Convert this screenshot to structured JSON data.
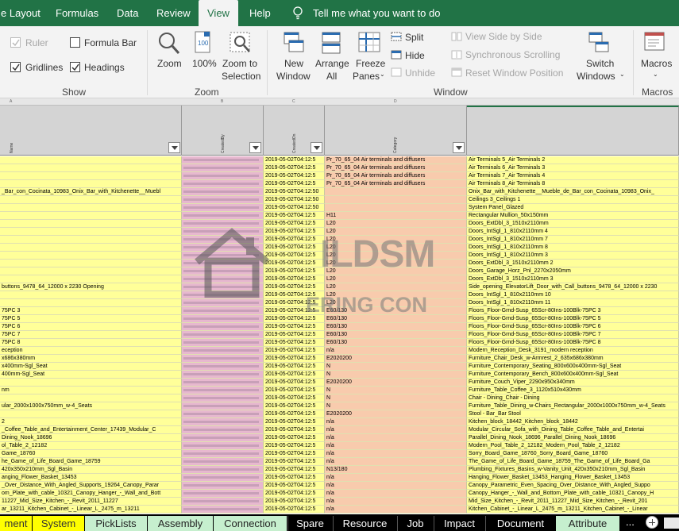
{
  "ribbon_tabs": [
    {
      "label": "e Layout"
    },
    {
      "label": "Formulas"
    },
    {
      "label": "Data"
    },
    {
      "label": "Review"
    },
    {
      "label": "View"
    },
    {
      "label": "Help"
    }
  ],
  "tell_me": "Tell me what you want to do",
  "show_group": {
    "label": "Show",
    "ruler": "Ruler",
    "formula_bar": "Formula Bar",
    "gridlines": "Gridlines",
    "headings": "Headings"
  },
  "zoom_group": {
    "label": "Zoom",
    "zoom": "Zoom",
    "hundred": "100%",
    "zoom_to_sel_1": "Zoom to",
    "zoom_to_sel_2": "Selection"
  },
  "window_group": {
    "label": "Window",
    "new_window_1": "New",
    "new_window_2": "Window",
    "arrange_1": "Arrange",
    "arrange_2": "All",
    "freeze_1": "Freeze",
    "freeze_2": "Panes",
    "split": "Split",
    "hide": "Hide",
    "unhide": "Unhide",
    "side_by_side": "View Side by Side",
    "sync_scroll": "Synchronous Scrolling",
    "reset_pos": "Reset Window Position",
    "switch_1": "Switch",
    "switch_2": "Windows"
  },
  "macros_group": {
    "label": "Macros",
    "macros": "Macros"
  },
  "column_letters": [
    "A",
    "B",
    "C",
    "D"
  ],
  "headers": {
    "name": "Name",
    "created_by": "CreatedBy",
    "created_on": "CreatedOn",
    "category": "Category"
  },
  "rows": [
    {
      "a": "",
      "c": "2019-05-02T04:12:5",
      "d": "Pr_70_65_04 Air terminals and diffusers",
      "e": "Air Terminals 5_Air Terminals 2"
    },
    {
      "a": "",
      "c": "2019-05-02T04:12:5",
      "d": "Pr_70_65_04 Air terminals and diffusers",
      "e": "Air Terminals 6_Air Terminals 3"
    },
    {
      "a": "",
      "c": "2019-05-02T04:12:5",
      "d": "Pr_70_65_04 Air terminals and diffusers",
      "e": "Air Terminals 7_Air Terminals 4"
    },
    {
      "a": "",
      "c": "2019-05-02T04:12:5",
      "d": "Pr_70_65_04 Air terminals and diffusers",
      "e": "Air Terminals 8_Air Terminals 8"
    },
    {
      "a": "_Bar_con_Cocinata_10983_Onix_Bar_with_Kitchenette__Muebl",
      "c": "2019-05-02T04:12:50",
      "d": "",
      "e": "Onix_Bar_with_Kitchenette__Mueble_de_Bar_con_Cocinata_10983_Onix_"
    },
    {
      "a": "",
      "c": "2019-05-02T04:12:50",
      "d": "",
      "e": "Ceilings 3_Ceilings 1"
    },
    {
      "a": "",
      "c": "2019-05-02T04:12:50",
      "d": "",
      "e": "System Panel_Glazed"
    },
    {
      "a": "",
      "c": "2019-05-02T04:12:5",
      "d": "H11",
      "e": "Rectangular Mullion_50x150mm"
    },
    {
      "a": "",
      "c": "2019-05-02T04:12:5",
      "d": "L20",
      "e": "Doors_ExtDbl_3_1510x2110mm"
    },
    {
      "a": "",
      "c": "2019-05-02T04:12:5",
      "d": "L20",
      "e": "Doors_IntSgl_1_810x2110mm 4"
    },
    {
      "a": "",
      "c": "2019-05-02T04:12:5",
      "d": "L20",
      "e": "Doors_IntSgl_1_810x2110mm 7"
    },
    {
      "a": "",
      "c": "2019-05-02T04:12:5",
      "d": "L20",
      "e": "Doors_IntSgl_1_810x2110mm 8"
    },
    {
      "a": "",
      "c": "2019-05-02T04:12:5",
      "d": "L20",
      "e": "Doors_IntSgl_1_810x2110mm 3"
    },
    {
      "a": "",
      "c": "2019-05-02T04:12:5",
      "d": "L20",
      "e": "Doors_ExtDbl_3_1510x2110mm 2"
    },
    {
      "a": "",
      "c": "2019-05-02T04:12:5",
      "d": "L20",
      "e": "Doors_Garage_Horz_Pnl_2270x2050mm"
    },
    {
      "a": "",
      "c": "2019-05-02T04:12:5",
      "d": "L20",
      "e": "Doors_ExtDbl_3_1510x2110mm 3"
    },
    {
      "a": "buttons_9478_64_12000 x 2230 Opening",
      "c": "2019-05-02T04:12:5",
      "d": "L20",
      "e": "Side_opening_ElevatorLift_Door_with_Call_buttons_9478_64_12000 x 2230"
    },
    {
      "a": "",
      "c": "2019-05-02T04:12:5",
      "d": "L20",
      "e": "Doors_IntSgl_1_810x2110mm 10"
    },
    {
      "a": "",
      "c": "2019-05-02T04:12:5",
      "d": "L20",
      "e": "Doors_IntSgl_1_810x2110mm 11"
    },
    {
      "a": "75PC 3",
      "c": "2019-05-02T04:12:5",
      "d": "E60/130",
      "e": "Floors_Floor-Grnd-Susp_65Scr-80Ins-100Blk-75PC 3"
    },
    {
      "a": "75PC 5",
      "c": "2019-05-02T04:12:5",
      "d": "E60/130",
      "e": "Floors_Floor-Grnd-Susp_65Scr-80Ins-100Blk-75PC 5"
    },
    {
      "a": "75PC 6",
      "c": "2019-05-02T04:12:5",
      "d": "E60/130",
      "e": "Floors_Floor-Grnd-Susp_65Scr-80Ins-100Blk-75PC 6"
    },
    {
      "a": "75PC 7",
      "c": "2019-05-02T04:12:5",
      "d": "E60/130",
      "e": "Floors_Floor-Grnd-Susp_65Scr-80Ins-100Blk-75PC 7"
    },
    {
      "a": "75PC 8",
      "c": "2019-05-02T04:12:5",
      "d": "E60/130",
      "e": "Floors_Floor-Grnd-Susp_65Scr-80Ins-100Blk-75PC 8"
    },
    {
      "a": "eception",
      "c": "2019-05-02T04:12:5",
      "d": "n/a",
      "e": "Modern_Reception_Desk_3191_modern reception"
    },
    {
      "a": "x686x380mm",
      "c": "2019-05-02T04:12:5",
      "d": "E2020200",
      "e": "Furniture_Chair_Desk_w-Armrest_2_635x686x380mm"
    },
    {
      "a": "x400mm-Sgl_Seat",
      "c": "2019-05-02T04:12:5",
      "d": "N",
      "e": "Furniture_Contemporary_Seating_800x600x400mm-Sgl_Seat"
    },
    {
      "a": "400mm-Sgl_Seat",
      "c": "2019-05-02T04:12:5",
      "d": "N",
      "e": "Furniture_Contemporary_Bench_800x600x400mm-Sgl_Seat"
    },
    {
      "a": "",
      "c": "2019-05-02T04:12:5",
      "d": "E2020200",
      "e": "Furniture_Couch_Viper_2290x950x340mm"
    },
    {
      "a": "nm",
      "c": "2019-05-02T04:12:5",
      "d": "N",
      "e": "Furniture_Table_Coffee_3_1120x510x430mm"
    },
    {
      "a": "",
      "c": "2019-05-02T04:12:5",
      "d": "N",
      "e": "Chair - Dining_Chair - Dining"
    },
    {
      "a": "ular_2000x1000x750mm_w-4_Seats",
      "c": "2019-05-02T04:12:5",
      "d": "N",
      "e": "Furniture_Table_Dining_w-Chairs_Rectangular_2000x1000x750mm_w-4_Seats"
    },
    {
      "a": "",
      "c": "2019-05-02T04:12:5",
      "d": "E2020200",
      "e": "Stool - Bar_Bar Stool"
    },
    {
      "a": "2",
      "c": "2019-05-02T04:12:5",
      "d": "n/a",
      "e": "Kitchen_block_18442_Kitchen_block_18442"
    },
    {
      "a": "_Coffee_Table_and_Entertainment_Center_17439_Modular_C",
      "c": "2019-05-02T04:12:5",
      "d": "n/a",
      "e": "Modular_Circular_Sofa_with_Dining_Table_Coffee_Table_and_Entertai"
    },
    {
      "a": "Dining_Nook_18696",
      "c": "2019-05-02T04:12:5",
      "d": "n/a",
      "e": "Parallel_Dining_Nook_18696_Parallel_Dining_Nook_18696"
    },
    {
      "a": "ol_Table_2_12182",
      "c": "2019-05-02T04:12:5",
      "d": "n/a",
      "e": "Modern_Pool_Table_2_12182_Modern_Pool_Table_2_12182"
    },
    {
      "a": "Game_18760",
      "c": "2019-05-02T04:12:5",
      "d": "n/a",
      "e": "Sorry_Board_Game_18760_Sorry_Board_Game_18760"
    },
    {
      "a": "he_Game_of_Life_Board_Game_18759",
      "c": "2019-05-02T04:12:5",
      "d": "n/a",
      "e": "The_Game_of_Life_Board_Game_18759_The_Game_of_Life_Board_Ga"
    },
    {
      "a": "420x350x210mm_Sgl_Basin",
      "c": "2019-05-02T04:12:5",
      "d": "N13/180",
      "e": "Plumbing_Fixtures_Basins_w-Vanity_Unit_420x350x210mm_Sgl_Basin"
    },
    {
      "a": "anging_Flower_Basket_13453",
      "c": "2019-05-02T04:12:5",
      "d": "n/a",
      "e": "Hanging_Flower_Basket_13453_Hanging_Flower_Basket_13453"
    },
    {
      "a": "_Over_Distance_With_Angled_Supports_19264_Canopy_Parar",
      "c": "2019-05-02T04:12:5",
      "d": "n/a",
      "e": "Canopy_Parametric_Even_Spacing_Over_Distance_With_Angled_Suppo"
    },
    {
      "a": "om_Plate_with_cable_10321_Canopy_Hanger_-_Wall_and_Bott",
      "c": "2019-05-02T04:12:5",
      "d": "n/a",
      "e": "Canopy_Hanger_-_Wall_and_Bottom_Plate_with_cable_10321_Canopy_H"
    },
    {
      "a": "11227_Mid_Size_Kitchen_-_Revit_2011_11227",
      "c": "2019-05-02T04:12:5",
      "d": "n/a",
      "e": "Mid_Size_Kitchen_-_Revit_2011_11227_Mid_Size_Kitchen_-_Revit_201"
    },
    {
      "a": "ar_13211_Kitchen_Cabinet_-_Linear_L_2475_m_13211",
      "c": "2019-05-02T04:12:5",
      "d": "n/a",
      "e": "Kitchen_Cabinet_-_Linear_L_2475_m_13211_Kitchen_Cabinet_-_Linear"
    }
  ],
  "sheet_tabs": [
    {
      "label": "ment",
      "style": "first"
    },
    {
      "label": "System",
      "style": "active"
    },
    {
      "label": "PickLists",
      "style": "green"
    },
    {
      "label": "Assembly",
      "style": "green"
    },
    {
      "label": "Connection",
      "style": "green"
    },
    {
      "label": "Spare",
      "style": "black"
    },
    {
      "label": "Resource",
      "style": "black"
    },
    {
      "label": "Job",
      "style": "black"
    },
    {
      "label": "Impact",
      "style": "black"
    },
    {
      "label": "Document",
      "style": "black"
    },
    {
      "label": "Attribute",
      "style": "green"
    }
  ],
  "more_tabs": "...",
  "watermark": {
    "name": "ILDSM",
    "sub": "ERING CON"
  },
  "colors": {
    "excel_green": "#217346",
    "yellow": "#ffff99",
    "salmon": "#f8cbad",
    "pink": "#e7b8cf"
  }
}
